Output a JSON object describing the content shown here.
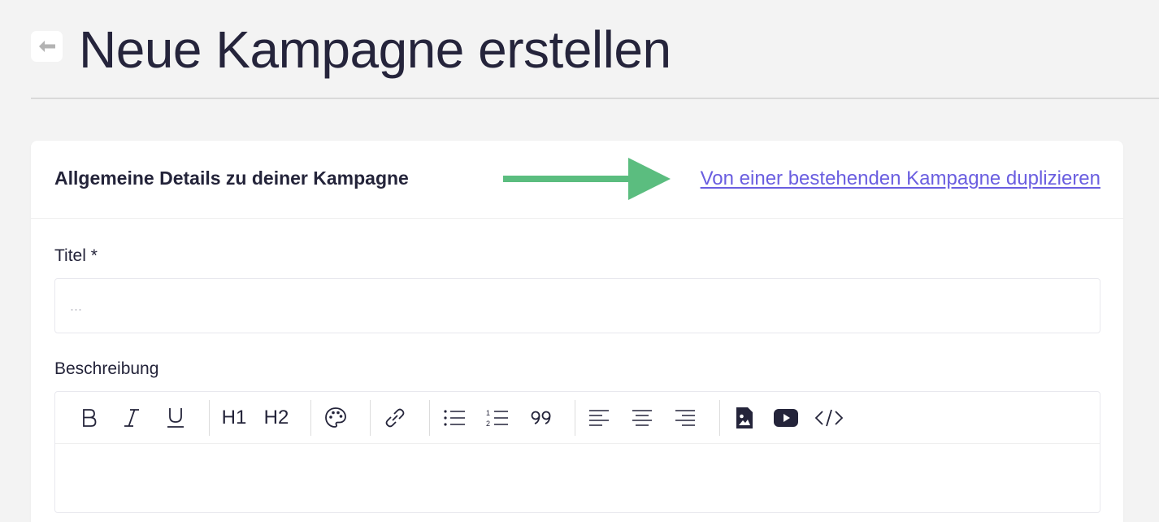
{
  "header": {
    "back_icon": "arrow-left-icon",
    "title": "Neue Kampagne erstellen"
  },
  "card": {
    "title": "Allgemeine Details zu deiner Kampagne",
    "duplicate_link": "Von einer bestehenden Kampagne duplizieren",
    "annotation_arrow_color": "#5bbd7f"
  },
  "form": {
    "title_label": "Titel *",
    "title_placeholder": "...",
    "title_value": "",
    "description_label": "Beschreibung"
  },
  "toolbar": {
    "bold": "B",
    "italic": "I",
    "underline": "U",
    "h1": "H1",
    "h2": "H2",
    "icons": [
      "palette-icon",
      "link-icon",
      "bullet-list-icon",
      "numbered-list-icon",
      "quote-icon",
      "align-left-icon",
      "align-center-icon",
      "align-right-icon",
      "image-icon",
      "youtube-icon",
      "code-icon"
    ]
  },
  "colors": {
    "background": "#f3f3f3",
    "text": "#24243a",
    "link": "#6a5ee0",
    "arrow": "#5bbd7f"
  }
}
